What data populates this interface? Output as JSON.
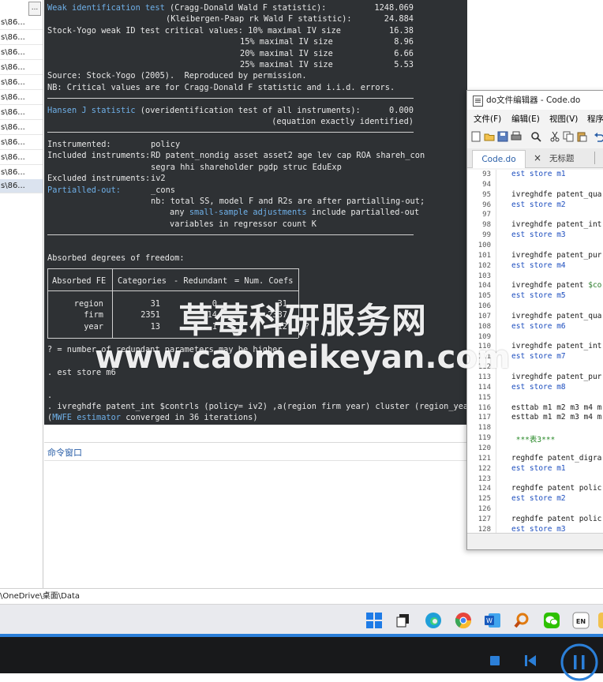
{
  "sidebar": {
    "button_label": "...",
    "items": [
      "s\\86...",
      "s\\86...",
      "s\\86...",
      "s\\86...",
      "s\\86...",
      "s\\86...",
      "s\\86...",
      "s\\86...",
      "s\\86...",
      "s\\86...",
      "s\\86...",
      "s\\86..."
    ]
  },
  "results": {
    "weak_id_label": "Weak identification test",
    "weak_id_line1_rest": " (Cragg-Donald Wald F statistic):",
    "weak_id_value1": "1248.069",
    "weak_id_line2": "(Kleibergen-Paap rk Wald F statistic):",
    "weak_id_value2": "24.884",
    "sy_line1": "Stock-Yogo weak ID test critical values: 10% maximal IV size",
    "sy_value1": "16.38",
    "sy_line2": "15% maximal IV size",
    "sy_value2": "8.96",
    "sy_line3": "20% maximal IV size",
    "sy_value3": "6.66",
    "sy_line4": "25% maximal IV size",
    "sy_value4": "5.53",
    "source_line": "Source: Stock-Yogo (2005).  Reproduced by permission.",
    "nb_line": "NB: Critical values are for Cragg-Donald F statistic and i.i.d. errors.",
    "hansen_label": "Hansen J statistic",
    "hansen_rest": " (overidentification test of all instruments):",
    "hansen_value": "0.000",
    "hansen_note": "(equation exactly identified)",
    "instrumented_label": "Instrumented:",
    "instrumented_value": "policy",
    "included_label": "Included instruments:",
    "included_value1": "RD patent_nondig asset asset2 age lev cap ROA shareh_con",
    "included_value2": "segra hhi shareholder pgdp struc EduExp",
    "excluded_label": "Excluded instruments:",
    "excluded_value": "iv2",
    "partialled_label": "Partialled-out:",
    "partialled_value": "_cons",
    "nb2_line1": "nb: total SS, model F and R2s are after partialling-out;",
    "nb2_line2_pre": "any ",
    "nb2_line2_link": "small-sample adjustments",
    "nb2_line2_post": " include partialled-out",
    "nb2_line3": "variables in regressor count K",
    "absorbed_title": "Absorbed degrees of freedom:",
    "absorbed_table": {
      "headers": [
        "Absorbed FE",
        "Categories",
        "- Redundant",
        "= Num. Coefs"
      ],
      "rows": [
        {
          "fe": "region",
          "categories": "31",
          "redundant": "0",
          "coefs": "31"
        },
        {
          "fe": "firm",
          "categories": "2351",
          "redundant": "14",
          "coefs": "2337"
        },
        {
          "fe": "year",
          "categories": "13",
          "redundant": "1",
          "coefs": "12",
          "flag": "?"
        }
      ]
    },
    "redundant_note": "? = number of redundant parameters may be higher",
    "cmd1": ". est store m6",
    "cmd2": ".",
    "cmd3": ". ivreghdfe patent_int $contrls (policy= iv2) ,a(region firm year) cluster (region_year)",
    "mwfe_open": "(",
    "mwfe_link": "MWFE estimator",
    "mwfe_rest": " converged in 36 iterations)"
  },
  "command_window": {
    "title": "命令窗口"
  },
  "editor": {
    "title": "do文件编辑器 - Code.do",
    "menu": [
      "文件(F)",
      "编辑(E)",
      "视图(V)",
      "程序"
    ],
    "tabs": [
      "Code.do",
      "无标题"
    ],
    "lines": [
      {
        "n": "93",
        "t": "est store m1",
        "kind": "res"
      },
      {
        "n": "94",
        "t": ""
      },
      {
        "n": "95",
        "t": "ivreghdfe patent_qua"
      },
      {
        "n": "96",
        "t": "est store m2",
        "kind": "res"
      },
      {
        "n": "97",
        "t": ""
      },
      {
        "n": "98",
        "t": "ivreghdfe patent_int"
      },
      {
        "n": "99",
        "t": "est store m3",
        "kind": "res"
      },
      {
        "n": "100",
        "t": ""
      },
      {
        "n": "101",
        "t": "ivreghdfe patent_pur"
      },
      {
        "n": "102",
        "t": "est store m4",
        "kind": "res"
      },
      {
        "n": "103",
        "t": ""
      },
      {
        "n": "104",
        "t": "ivreghdfe patent ",
        "mac": "$co"
      },
      {
        "n": "105",
        "t": "est store m5",
        "kind": "res"
      },
      {
        "n": "106",
        "t": ""
      },
      {
        "n": "107",
        "t": "ivreghdfe patent_qua"
      },
      {
        "n": "108",
        "t": "est store m6",
        "kind": "res"
      },
      {
        "n": "109",
        "t": ""
      },
      {
        "n": "110",
        "t": "ivreghdfe patent_int"
      },
      {
        "n": "111",
        "t": "est store m7",
        "kind": "res"
      },
      {
        "n": "112",
        "t": ""
      },
      {
        "n": "113",
        "t": "ivreghdfe patent_pur"
      },
      {
        "n": "114",
        "t": "est store m8",
        "kind": "res"
      },
      {
        "n": "115",
        "t": ""
      },
      {
        "n": "116",
        "t": "esttab m1 m2 m3 m4 m"
      },
      {
        "n": "117",
        "t": "esttab m1 m2 m3 m4 m"
      },
      {
        "n": "118",
        "t": ""
      },
      {
        "n": "119",
        "t": " ***表3***",
        "kind": "cmt"
      },
      {
        "n": "120",
        "t": ""
      },
      {
        "n": "121",
        "t": "reghdfe patent_digra"
      },
      {
        "n": "122",
        "t": "est store m1",
        "kind": "res"
      },
      {
        "n": "123",
        "t": ""
      },
      {
        "n": "124",
        "t": "reghdfe patent polic"
      },
      {
        "n": "125",
        "t": "est store m2",
        "kind": "res"
      },
      {
        "n": "126",
        "t": ""
      },
      {
        "n": "127",
        "t": "reghdfe patent polic"
      },
      {
        "n": "128",
        "t": "est store m3",
        "kind": "res"
      }
    ]
  },
  "pathbar": {
    "path": "\\OneDrive\\桌面\\Data"
  },
  "watermark": {
    "line1": "草莓科研服务网",
    "line2": "www.caomeikeyan.com"
  },
  "colors": {
    "results_bg": "#2e3134",
    "link_blue": "#6fb0e8",
    "player_accent": "#2b7fd8"
  }
}
